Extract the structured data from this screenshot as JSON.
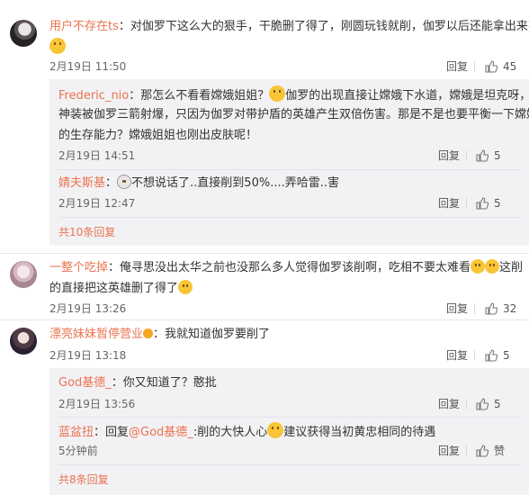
{
  "comments": [
    {
      "user": "用户不存在ts",
      "text": "：对伽罗下这么大的狠手，干脆删了得了，刚圆玩钱就削，伽罗以后还能拿出来不能",
      "time": "2月19日 11:50",
      "reply_label": "回复",
      "likes": "45",
      "replies": [
        {
          "user": "Frederic_nio",
          "text1": "：那怎么不看看嫦娥姐姐？",
          "text1b": "伽罗的出现直接让嫦娥下水道，嫦娥是坦克呀，六",
          "text2": "神装被伽罗三箭射爆，只因为伽罗对带护盾的英雄产生双倍伤害。那是不是也要平衡一下嫦娥",
          "text3": "的生存能力？嫦娥姐姐也刚出皮肤呢！",
          "time": "2月19日 14:51",
          "reply_label": "回复",
          "likes": "5"
        },
        {
          "user": "婧夫斯基",
          "text": "不想说话了..直接削到50%....弄哈雷..害",
          "time": "2月19日 12:47",
          "reply_label": "回复",
          "likes": "5"
        }
      ],
      "more": "共10条回复"
    },
    {
      "user": "一整个吃掉",
      "text1": "：俺寻思没出太华之前也没那么多人觉得伽罗该削啊，吃相不要太难看",
      "text1b": "这削",
      "text2": "的直接把这英雄删了得了",
      "time": "2月19日 13:26",
      "reply_label": "回复",
      "likes": "32"
    },
    {
      "user": "漂亮妹妹暂停营业",
      "text": "：我就知道伽罗要削了",
      "time": "2月19日 13:18",
      "reply_label": "回复",
      "likes": "5",
      "replies": [
        {
          "user": "God基德_",
          "text": "：你又知道了？憨批",
          "time": "2月19日 13:56",
          "reply_label": "回复",
          "likes": "5"
        },
        {
          "user": "蓝盆扭",
          "text_prefix": "：回复",
          "mention": "@God基德_",
          "text_mid": ":削的大快人心",
          "text_end": "建议获得当初黄忠相同的待遇",
          "time": "5分钟前",
          "reply_label": "回复",
          "likes": "赞"
        }
      ],
      "more": "共8条回复"
    }
  ]
}
